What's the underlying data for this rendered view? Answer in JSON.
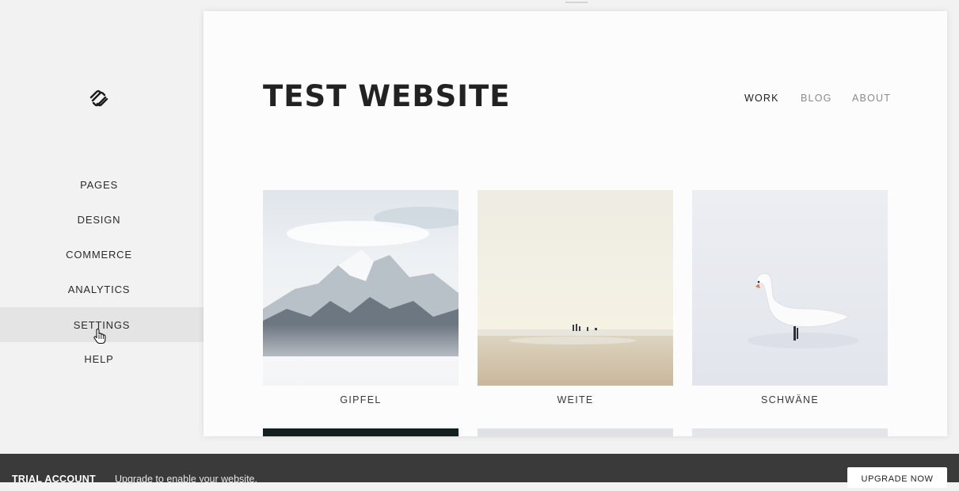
{
  "sidebar": {
    "logo": "squarespace-logo-icon",
    "items": [
      {
        "label": "PAGES"
      },
      {
        "label": "DESIGN"
      },
      {
        "label": "COMMERCE"
      },
      {
        "label": "ANALYTICS"
      },
      {
        "label": "SETTINGS",
        "active": true
      },
      {
        "label": "HELP"
      }
    ]
  },
  "preview": {
    "site_title": "TEST WEBSITE",
    "nav": [
      {
        "label": "WORK",
        "active": true
      },
      {
        "label": "BLOG"
      },
      {
        "label": "ABOUT"
      }
    ],
    "gallery": [
      {
        "caption": "GIPFEL",
        "image": "snowy-mountains-photo"
      },
      {
        "caption": "WEITE",
        "image": "beach-people-photo"
      },
      {
        "caption": "SCHWÄNE",
        "image": "swan-photo"
      }
    ]
  },
  "bottom_bar": {
    "trial_label": "TRIAL ACCOUNT",
    "message": "Upgrade to enable your website.",
    "button_label": "UPGRADE NOW"
  },
  "colors": {
    "sidebar_bg": "#f2f2f2",
    "active_item_bg": "#e4e4e4",
    "bottom_bar_bg": "#3a3a3a"
  }
}
